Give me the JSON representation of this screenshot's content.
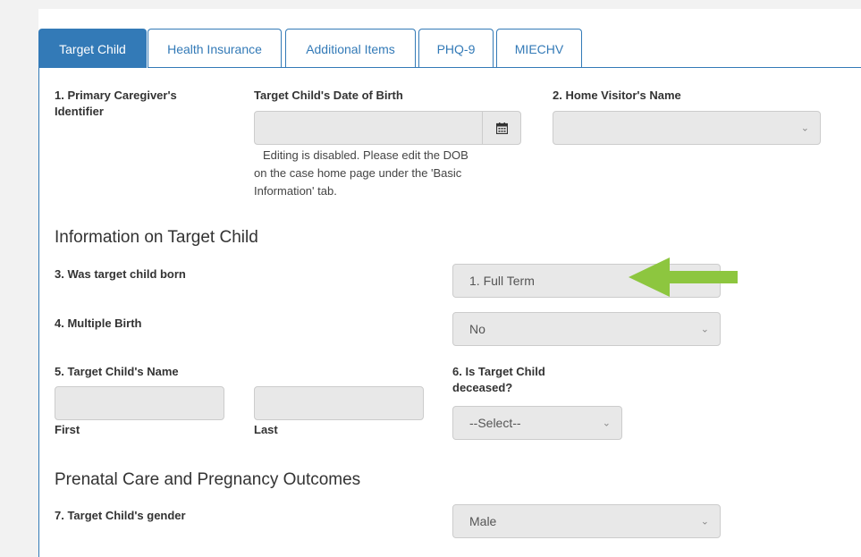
{
  "tabs": [
    {
      "label": "Target Child",
      "active": true
    },
    {
      "label": "Health Insurance",
      "active": false
    },
    {
      "label": "Additional Items",
      "active": false
    },
    {
      "label": "PHQ-9",
      "active": false
    },
    {
      "label": "MIECHV",
      "active": false
    }
  ],
  "fields": {
    "primary_caregiver_label_1": "1. Primary Caregiver's",
    "primary_caregiver_label_2": "Identifier",
    "dob_label": "Target Child's Date of Birth",
    "dob_value": "",
    "dob_help_1": "Editing is disabled. Please edit the DOB",
    "dob_help_2": "on the case home page under the 'Basic",
    "dob_help_3": "Information' tab.",
    "home_visitor_label": "2. Home Visitor's Name",
    "home_visitor_value": "",
    "born_label": "3. Was target child born",
    "born_value": "1. Full Term",
    "multiple_birth_label": "4. Multiple Birth",
    "multiple_birth_value": "No",
    "name_label": "5. Target Child's Name",
    "first_label": "First",
    "last_label": "Last",
    "deceased_label_1": "6. Is Target Child",
    "deceased_label_2": "deceased?",
    "deceased_value": "--Select--",
    "gender_label": "7. Target Child's gender",
    "gender_value": "Male"
  },
  "sections": {
    "info_title": "Information on Target Child",
    "prenatal_title": "Prenatal Care and Pregnancy Outcomes"
  },
  "colors": {
    "accent": "#337ab7",
    "arrow": "#8dc63f",
    "field_bg": "#e8e8e8"
  },
  "icons": {
    "calendar": "calendar-icon",
    "chevron": "chevron-down-icon",
    "annotation": "green-arrow-icon"
  }
}
